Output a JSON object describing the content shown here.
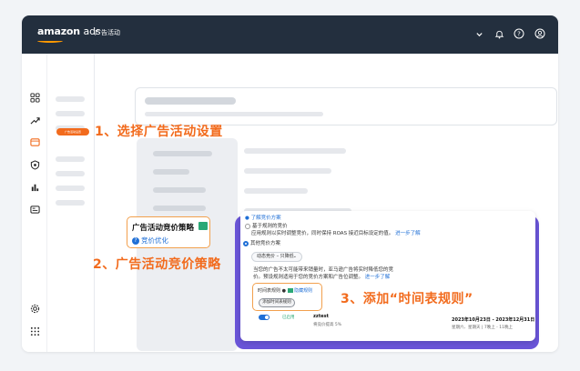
{
  "topbar": {
    "logo_bold": "amazon",
    "logo_light": "ads",
    "title": "广告活动",
    "icons": [
      "chevron-down-icon",
      "bell-icon",
      "help-icon",
      "account-icon"
    ]
  },
  "leftnav": {
    "icons": [
      "dashboard-icon",
      "trend-icon",
      "campaign-icon",
      "shield-icon",
      "bar-chart-icon",
      "media-icon",
      "settings-icon",
      "apps-grid-icon"
    ]
  },
  "subnav": {
    "selected_label": "广告活动设置"
  },
  "annotations": {
    "step1": "1、选择广告活动设置",
    "step2": "2、广告活动竞价策略",
    "step3": "3、添加“时间表规则”"
  },
  "strategy": {
    "title": "广告活动竞价策略",
    "sub": "竞价优化"
  },
  "popup": {
    "header_link": "了解竞价方案",
    "option1_title": "基于规则的竞价",
    "option1_desc": "应用规则以实时调整竞价，同时保持 ROAS 接近目标设定的值。",
    "option1_link": "进一步了解",
    "option2_title": "其他竞价方案",
    "dropdown_value": "动态竞价 – 只降低",
    "desc_line1": "当您的广告不太可能带来销量时，亚马逊广告将实时降低您的竞",
    "desc_line2": "价。预设规则适用于您的竞价方案和广告位调整。",
    "desc_link": "进一步了解",
    "rule_label": "时间表规则",
    "hide_rule": "隐藏规则",
    "add_rule_btn": "添加时间表规则",
    "row_status": "已启用",
    "row_name": "zztest",
    "row_sub": "将竞价提高 5%",
    "row_date": "2023年10月23日 - 2023年12月31日",
    "row_time": "星期六、星期天 | 7晚上 - 11晚上"
  },
  "colors": {
    "topbar": "#232f3e",
    "accent_orange": "#f26b1d",
    "link_blue": "#1f6fd6",
    "popup_shadow": "#6a55d8",
    "badge_green": "#2aa876"
  }
}
